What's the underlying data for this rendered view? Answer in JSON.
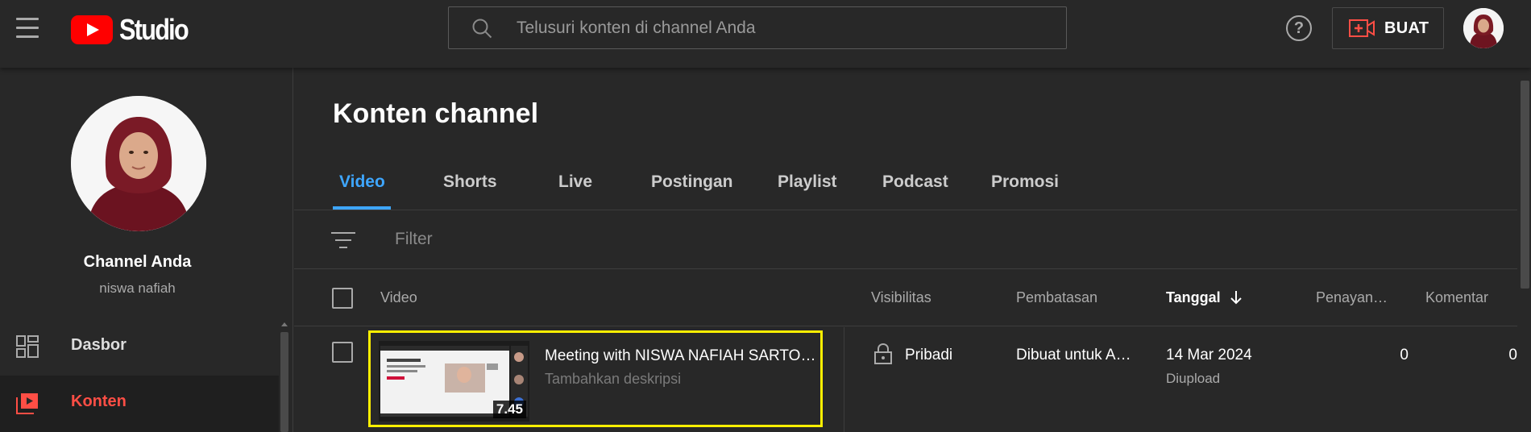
{
  "header": {
    "logo_text": "Studio",
    "search_placeholder": "Telusuri konten di channel Anda",
    "help_label": "?",
    "create_label": "BUAT",
    "brand_color": "#ff0000"
  },
  "sidebar": {
    "channel_title": "Channel Anda",
    "channel_handle": "niswa nafiah",
    "items": [
      {
        "label": "Dasbor",
        "icon": "dashboard-icon",
        "active": false
      },
      {
        "label": "Konten",
        "icon": "content-icon",
        "active": true
      }
    ]
  },
  "main": {
    "page_title": "Konten channel",
    "tabs": [
      {
        "label": "Video",
        "active": true
      },
      {
        "label": "Shorts"
      },
      {
        "label": "Live"
      },
      {
        "label": "Postingan"
      },
      {
        "label": "Playlist"
      },
      {
        "label": "Podcast"
      },
      {
        "label": "Promosi"
      }
    ],
    "filter_label": "Filter",
    "columns": {
      "video": "Video",
      "visibility": "Visibilitas",
      "restrictions": "Pembatasan",
      "date": "Tanggal",
      "views": "Penayan…",
      "comments": "Komentar"
    },
    "rows": [
      {
        "title": "Meeting with NISWA NAFIAH SARTONO",
        "description": "Tambahkan deskripsi",
        "duration": "7.45",
        "visibility": "Pribadi",
        "restrictions": "Dibuat untuk A…",
        "date": "14 Mar 2024",
        "date_status": "Diupload",
        "views": "0",
        "comments": "0"
      }
    ],
    "accent_color": "#3ea6ff",
    "highlight_color": "#ffef00"
  }
}
